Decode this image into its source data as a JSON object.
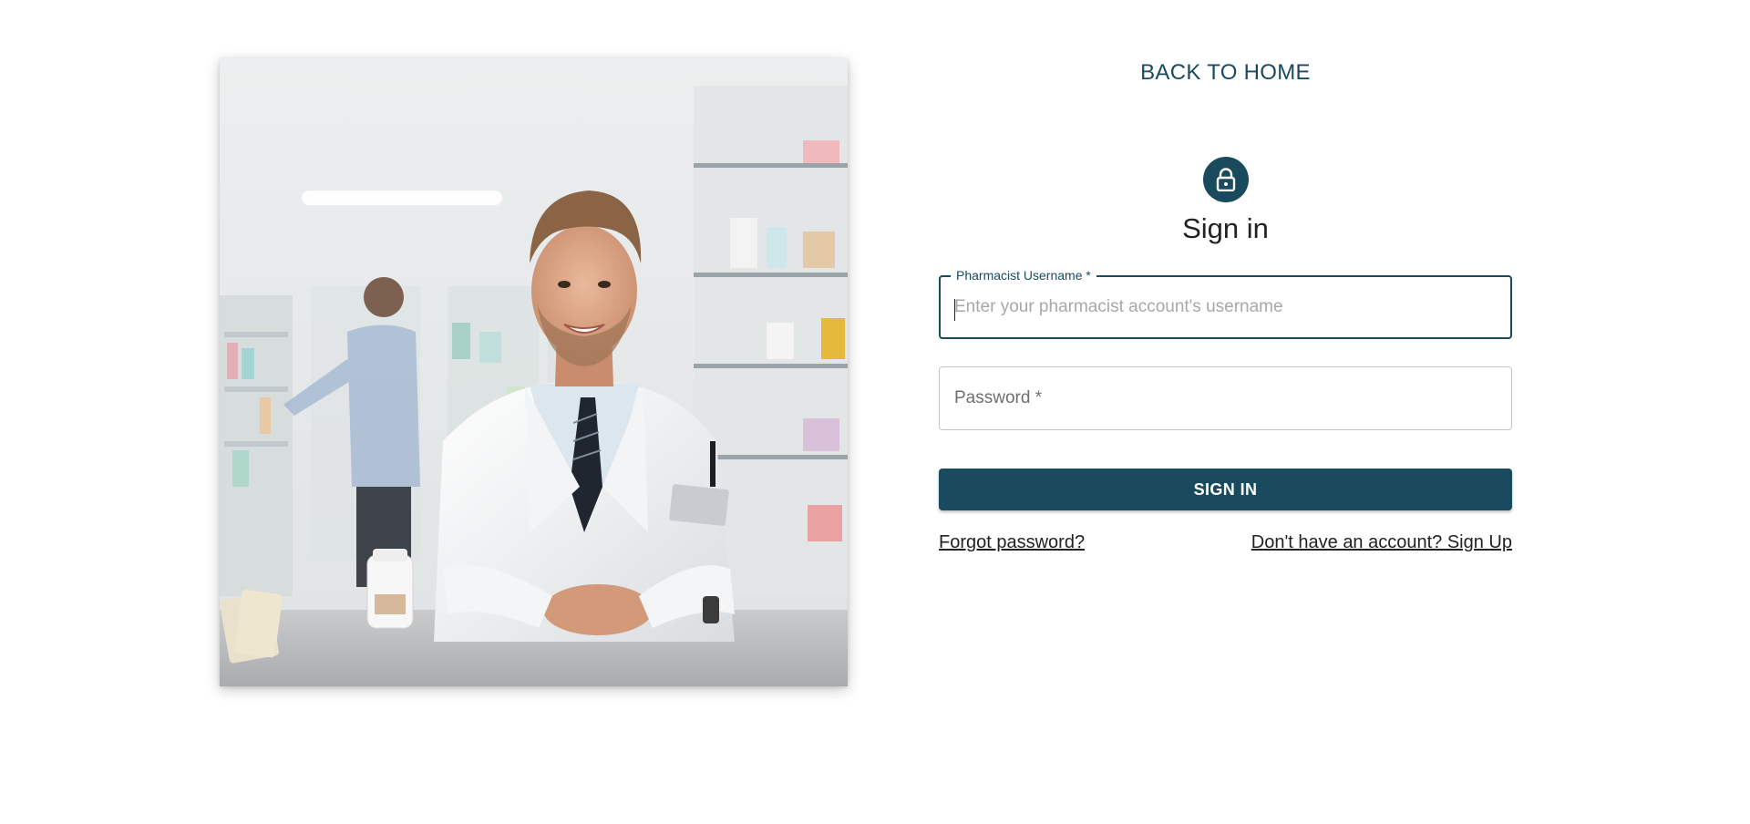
{
  "header": {
    "back_home": "BACK TO HOME"
  },
  "hero": {
    "image_alt": "Smiling pharmacist in a white coat standing at a pharmacy counter"
  },
  "form": {
    "lock_icon": "lock-icon",
    "title": "Sign in",
    "username": {
      "label": "Pharmacist Username *",
      "placeholder": "Enter your pharmacist account's username",
      "value": ""
    },
    "password": {
      "placeholder": "Password *",
      "value": ""
    },
    "submit_label": "SIGN IN",
    "forgot_password": "Forgot password?",
    "signup_link": "Don't have an account? Sign Up"
  },
  "colors": {
    "accent": "#1a4a5e",
    "text": "#222222",
    "border": "#c4c4c4"
  }
}
